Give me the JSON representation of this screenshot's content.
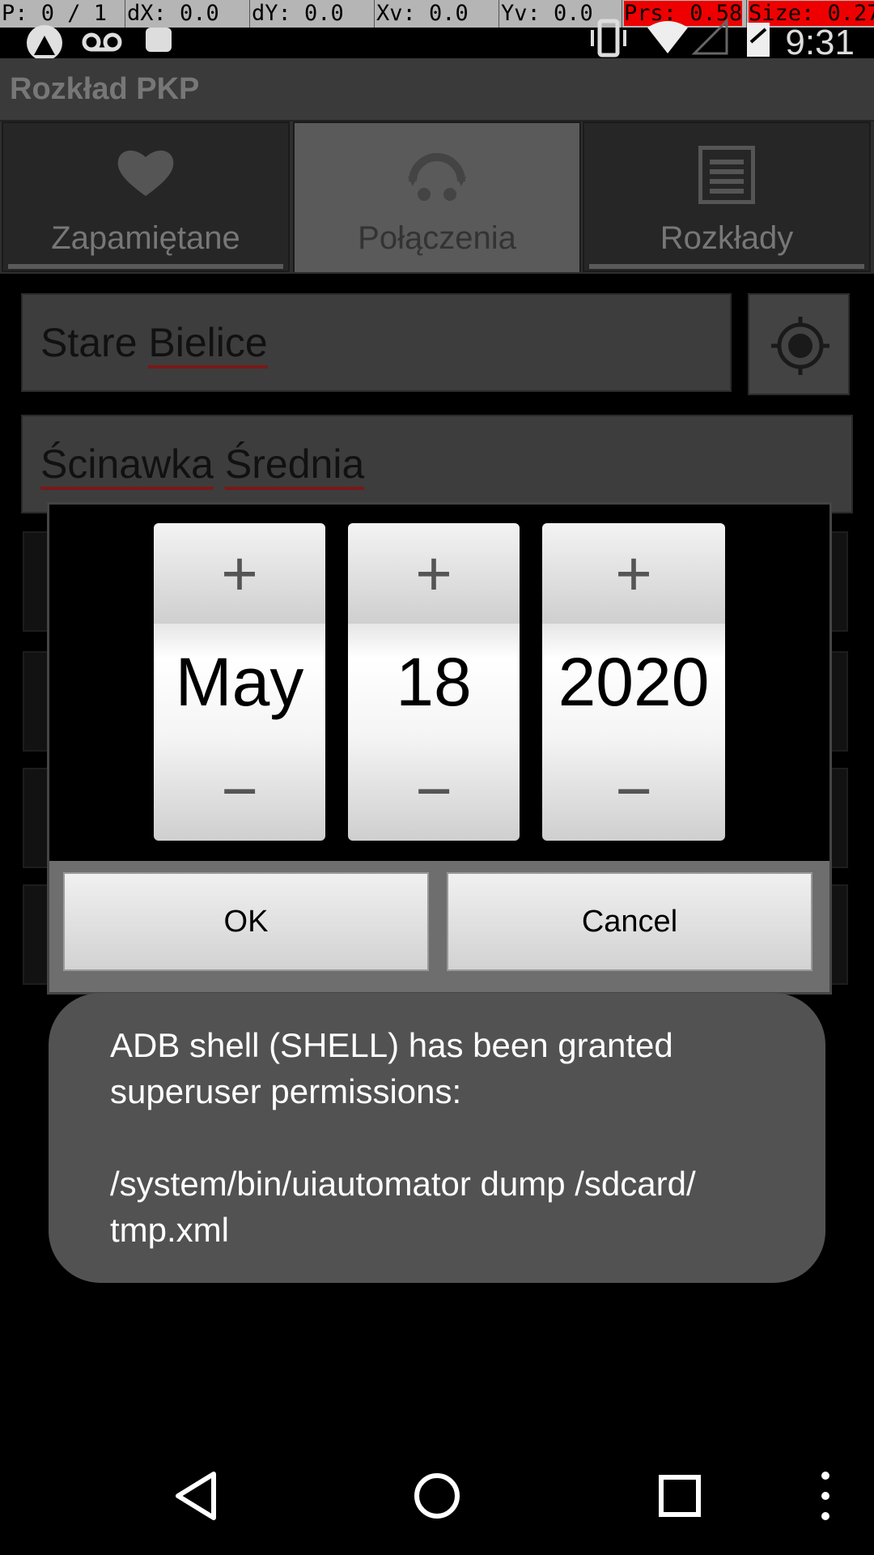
{
  "pointer_bar": {
    "p": "P: 0 / 1",
    "dx": "dX: 0.0",
    "dy": "dY: 0.0",
    "xv": "Xv: 0.0",
    "yv": "Yv: 0.0",
    "prs": "Prs: 0.58",
    "size": "Size: 0.27"
  },
  "status_bar": {
    "time": "9:31",
    "icons": [
      "app-notification-icon",
      "voicemail-icon",
      "android-icon",
      "vibrate-icon",
      "wifi-icon",
      "signal-icon",
      "battery-icon"
    ]
  },
  "app": {
    "title": "Rozkład PKP"
  },
  "tabs": [
    {
      "label": "Zapamiętane",
      "icon": "heart-icon",
      "selected": false
    },
    {
      "label": "Połączenia",
      "icon": "connections-icon",
      "selected": true
    },
    {
      "label": "Rozkłady",
      "icon": "schedule-icon",
      "selected": false
    }
  ],
  "stations": {
    "from_prefix": "Stare ",
    "from_word": "Bielice",
    "to_word1": "Ścinawka",
    "to_word2": "Średnia"
  },
  "date_picker": {
    "month": "May",
    "day": "18",
    "year": "2020",
    "plus": "+",
    "minus": "−"
  },
  "dialog": {
    "ok": "OK",
    "cancel": "Cancel"
  },
  "toast": {
    "message": "ADB shell (SHELL) has been granted\nsuperuser permissions:\n\n/system/bin/uiautomator dump /sdcard/\ntmp.xml"
  },
  "nav": [
    "back-icon",
    "home-icon",
    "recents-icon",
    "overflow-menu-icon"
  ]
}
